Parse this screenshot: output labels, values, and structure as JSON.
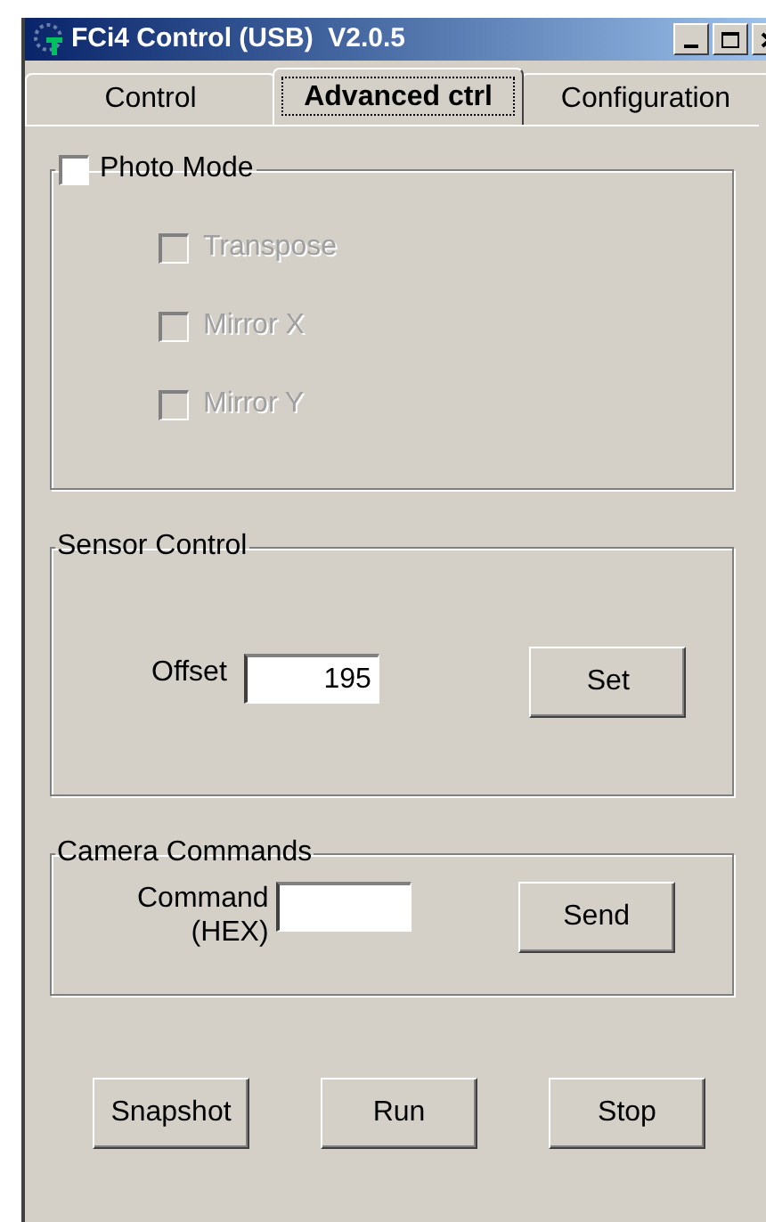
{
  "window": {
    "title": "FCi4 Control (USB)  V2.0.5"
  },
  "tabs": [
    {
      "label": "Control",
      "selected": false
    },
    {
      "label": "Advanced ctrl",
      "selected": true
    },
    {
      "label": "Configuration",
      "selected": false
    }
  ],
  "photo_mode": {
    "label": "Photo Mode",
    "checked": false,
    "options": [
      {
        "label": "Transpose",
        "checked": false,
        "disabled": true
      },
      {
        "label": "Mirror X",
        "checked": false,
        "disabled": true
      },
      {
        "label": "Mirror Y",
        "checked": false,
        "disabled": true
      }
    ]
  },
  "sensor_control": {
    "title": "Sensor Control",
    "offset_label": "Offset",
    "offset_value": "195",
    "button": "Set"
  },
  "camera_commands": {
    "title": "Camera Commands",
    "command_label": [
      "Command",
      "(HEX)"
    ],
    "button": "Send"
  },
  "buttons": [
    "Snapshot",
    "Run",
    "Stop"
  ]
}
